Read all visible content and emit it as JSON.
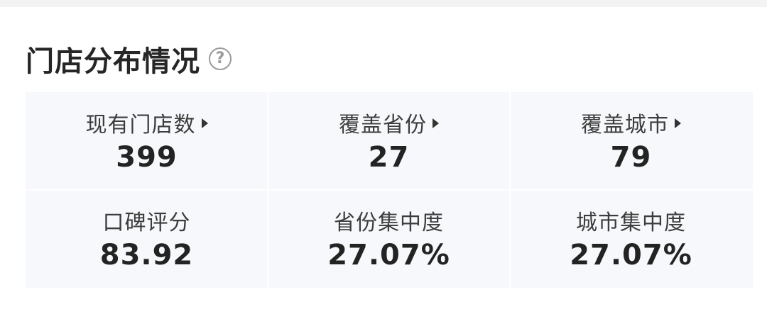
{
  "section": {
    "title": "门店分布情况",
    "help_icon": "question-circle-icon"
  },
  "stats": {
    "row1": [
      {
        "label": "现有门店数",
        "value": "399",
        "has_arrow": true
      },
      {
        "label": "覆盖省份",
        "value": "27",
        "has_arrow": true
      },
      {
        "label": "覆盖城市",
        "value": "79",
        "has_arrow": true
      }
    ],
    "row2": [
      {
        "label": "口碑评分",
        "value": "83.92",
        "has_arrow": false
      },
      {
        "label": "省份集中度",
        "value": "27.07%",
        "has_arrow": false
      },
      {
        "label": "城市集中度",
        "value": "27.07%",
        "has_arrow": false
      }
    ]
  },
  "colors": {
    "grid_background": "#f6f8fb",
    "text_primary": "#232323",
    "icon_grey": "#9a9a9a"
  }
}
